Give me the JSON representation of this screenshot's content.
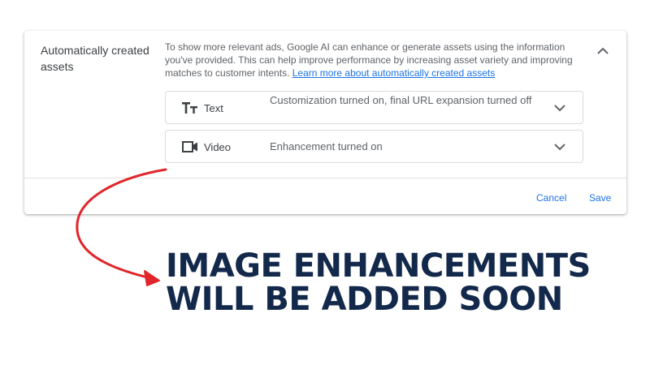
{
  "section": {
    "title": "Automatically created assets",
    "description": "To show more relevant ads, Google AI can enhance or generate assets using the information you've provided. This can help improve performance by increasing asset variety and improving matches to customer intents. ",
    "learn_more": "Learn more about automatically created assets"
  },
  "assets": [
    {
      "icon": "text-format-icon",
      "label": "Text",
      "status": "Customization turned on, final URL expansion turned off"
    },
    {
      "icon": "video-camera-icon",
      "label": "Video",
      "status": "Enhancement turned on"
    }
  ],
  "footer": {
    "cancel_label": "Cancel",
    "save_label": "Save"
  },
  "overlay": {
    "headline_line1": "IMAGE ENHANCEMENTS",
    "headline_line2": "WILL BE ADDED SOON",
    "arrow_color": "#e0262b",
    "headline_color": "#13294b"
  },
  "colors": {
    "link": "#1a73e8",
    "border": "#dadce0"
  }
}
